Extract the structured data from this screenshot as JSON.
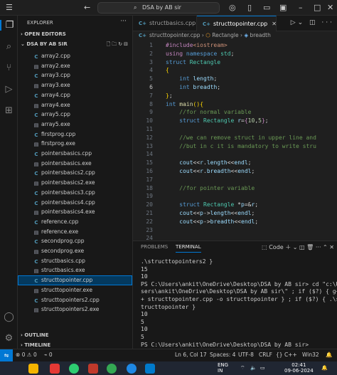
{
  "titlebar": {
    "search_text": "DSA by AB sir"
  },
  "explorer": {
    "title": "EXPLORER",
    "open_editors": "OPEN EDITORS",
    "folder": "DSA BY AB SIR",
    "files": [
      {
        "name": "array2.cpp",
        "type": "cpp"
      },
      {
        "name": "array2.exe",
        "type": "exe"
      },
      {
        "name": "array3.cpp",
        "type": "cpp"
      },
      {
        "name": "array3.exe",
        "type": "exe"
      },
      {
        "name": "array4.cpp",
        "type": "cpp"
      },
      {
        "name": "array4.exe",
        "type": "exe"
      },
      {
        "name": "array5.cpp",
        "type": "cpp"
      },
      {
        "name": "array5.exe",
        "type": "exe"
      },
      {
        "name": "firstprog.cpp",
        "type": "cpp"
      },
      {
        "name": "firstprog.exe",
        "type": "exe"
      },
      {
        "name": "pointersbasics.cpp",
        "type": "cpp"
      },
      {
        "name": "pointersbasics.exe",
        "type": "exe"
      },
      {
        "name": "pointersbasics2.cpp",
        "type": "cpp"
      },
      {
        "name": "pointersbasics2.exe",
        "type": "exe"
      },
      {
        "name": "pointersbasics3.cpp",
        "type": "cpp"
      },
      {
        "name": "pointersbasics4.cpp",
        "type": "cpp"
      },
      {
        "name": "pointersbasics4.exe",
        "type": "exe"
      },
      {
        "name": "reference.cpp",
        "type": "cpp"
      },
      {
        "name": "reference.exe",
        "type": "exe"
      },
      {
        "name": "secondprog.cpp",
        "type": "cpp"
      },
      {
        "name": "secondprog.exe",
        "type": "exe"
      },
      {
        "name": "structbasics.cpp",
        "type": "cpp"
      },
      {
        "name": "structbasics.exe",
        "type": "exe"
      },
      {
        "name": "structtopointer.cpp",
        "type": "cpp",
        "selected": true
      },
      {
        "name": "structtopointer.exe",
        "type": "exe"
      },
      {
        "name": "structtopointers2.cpp",
        "type": "cpp"
      },
      {
        "name": "structtopointers2.exe",
        "type": "exe"
      }
    ],
    "outline": "OUTLINE",
    "timeline": "TIMELINE"
  },
  "editor": {
    "tabs": [
      {
        "label": "structbasics.cpp",
        "active": false
      },
      {
        "label": "structtopointer.cpp",
        "active": true
      }
    ],
    "breadcrumb": {
      "file": "structtopointer.cpp",
      "struct": "Rectangle",
      "member": "breadth"
    },
    "current_line": 6,
    "code": [
      [
        {
          "c": "p",
          "t": "#include"
        },
        {
          "c": "s",
          "t": "<iostream>"
        }
      ],
      [
        {
          "c": "p",
          "t": "using"
        },
        {
          "c": "o",
          "t": " "
        },
        {
          "c": "k",
          "t": "namespace"
        },
        {
          "c": "o",
          "t": " "
        },
        {
          "c": "t",
          "t": "std"
        },
        {
          "c": "o",
          "t": ";"
        }
      ],
      [
        {
          "c": "k",
          "t": "struct"
        },
        {
          "c": "o",
          "t": " "
        },
        {
          "c": "t",
          "t": "Rectangle"
        }
      ],
      [
        {
          "c": "y",
          "t": "{"
        }
      ],
      [
        {
          "c": "o",
          "t": "    "
        },
        {
          "c": "k",
          "t": "int"
        },
        {
          "c": "o",
          "t": " "
        },
        {
          "c": "v",
          "t": "length"
        },
        {
          "c": "o",
          "t": ";"
        }
      ],
      [
        {
          "c": "o",
          "t": "    "
        },
        {
          "c": "k",
          "t": "int"
        },
        {
          "c": "o",
          "t": " "
        },
        {
          "c": "v",
          "t": "breadth"
        },
        {
          "c": "o",
          "t": ";"
        }
      ],
      [
        {
          "c": "y",
          "t": "}"
        },
        {
          "c": "o",
          "t": ";"
        }
      ],
      [
        {
          "c": "k",
          "t": "int"
        },
        {
          "c": "o",
          "t": " "
        },
        {
          "c": "f",
          "t": "main"
        },
        {
          "c": "y",
          "t": "()"
        },
        {
          "c": "y",
          "t": "{"
        }
      ],
      [
        {
          "c": "o",
          "t": "    "
        },
        {
          "c": "c",
          "t": "//for normal variable"
        }
      ],
      [
        {
          "c": "o",
          "t": "    "
        },
        {
          "c": "k",
          "t": "struct"
        },
        {
          "c": "o",
          "t": " "
        },
        {
          "c": "t",
          "t": "Rectangle"
        },
        {
          "c": "o",
          "t": " "
        },
        {
          "c": "v",
          "t": "r"
        },
        {
          "c": "o",
          "t": "="
        },
        {
          "c": "p",
          "t": "{"
        },
        {
          "c": "n",
          "t": "10"
        },
        {
          "c": "o",
          "t": ","
        },
        {
          "c": "n",
          "t": "5"
        },
        {
          "c": "p",
          "t": "}"
        },
        {
          "c": "o",
          "t": ";"
        }
      ],
      [],
      [
        {
          "c": "o",
          "t": "    "
        },
        {
          "c": "c",
          "t": "//we can remove struct in upper line and"
        }
      ],
      [
        {
          "c": "o",
          "t": "    "
        },
        {
          "c": "c",
          "t": "//but in c it is mandatory to write stru"
        }
      ],
      [],
      [
        {
          "c": "o",
          "t": "    "
        },
        {
          "c": "v",
          "t": "cout"
        },
        {
          "c": "o",
          "t": "<<"
        },
        {
          "c": "v",
          "t": "r"
        },
        {
          "c": "o",
          "t": "."
        },
        {
          "c": "v",
          "t": "length"
        },
        {
          "c": "o",
          "t": "<<"
        },
        {
          "c": "v",
          "t": "endl"
        },
        {
          "c": "o",
          "t": ";"
        }
      ],
      [
        {
          "c": "o",
          "t": "    "
        },
        {
          "c": "v",
          "t": "cout"
        },
        {
          "c": "o",
          "t": "<<"
        },
        {
          "c": "v",
          "t": "r"
        },
        {
          "c": "o",
          "t": "."
        },
        {
          "c": "v",
          "t": "breadth"
        },
        {
          "c": "o",
          "t": "<<"
        },
        {
          "c": "v",
          "t": "endl"
        },
        {
          "c": "o",
          "t": ";"
        }
      ],
      [],
      [
        {
          "c": "o",
          "t": "    "
        },
        {
          "c": "c",
          "t": "//for pointer variable"
        }
      ],
      [],
      [
        {
          "c": "o",
          "t": "    "
        },
        {
          "c": "k",
          "t": "struct"
        },
        {
          "c": "o",
          "t": " "
        },
        {
          "c": "t",
          "t": "Rectangle"
        },
        {
          "c": "o",
          "t": " *"
        },
        {
          "c": "v",
          "t": "p"
        },
        {
          "c": "o",
          "t": "=&"
        },
        {
          "c": "v",
          "t": "r"
        },
        {
          "c": "o",
          "t": ";"
        }
      ],
      [
        {
          "c": "o",
          "t": "    "
        },
        {
          "c": "v",
          "t": "cout"
        },
        {
          "c": "o",
          "t": "<<"
        },
        {
          "c": "v",
          "t": "p"
        },
        {
          "c": "o",
          "t": "->"
        },
        {
          "c": "v",
          "t": "length"
        },
        {
          "c": "o",
          "t": "<<"
        },
        {
          "c": "v",
          "t": "endl"
        },
        {
          "c": "o",
          "t": ";"
        }
      ],
      [
        {
          "c": "o",
          "t": "    "
        },
        {
          "c": "v",
          "t": "cout"
        },
        {
          "c": "o",
          "t": "<<"
        },
        {
          "c": "v",
          "t": "p"
        },
        {
          "c": "o",
          "t": "->"
        },
        {
          "c": "v",
          "t": "breadth"
        },
        {
          "c": "o",
          "t": "<<"
        },
        {
          "c": "v",
          "t": "endl"
        },
        {
          "c": "o",
          "t": ";"
        }
      ],
      [],
      []
    ]
  },
  "panel": {
    "tabs": [
      "PROBLEMS",
      "TERMINAL"
    ],
    "active_tab": "TERMINAL",
    "shell_label": "Code",
    "terminal_lines": [
      ".\\structtopointers2 }",
      "15",
      "10",
      "PS C:\\Users\\ankit\\OneDrive\\Desktop\\DSA by AB sir> cd \"c:\\U",
      "sers\\ankit\\OneDrive\\Desktop\\DSA by AB sir\\\" ; if ($?) { g+",
      "+ structtopointer.cpp -o structtopointer } ; if ($?) { .\\s",
      "tructtopointer }",
      "10",
      "5",
      "10",
      "5",
      "PS C:\\Users\\ankit\\OneDrive\\Desktop\\DSA by AB sir> "
    ]
  },
  "statusbar": {
    "errors": "0",
    "warnings": "0",
    "ports": "0",
    "position": "Ln 6, Col 17",
    "spaces": "Spaces: 4",
    "encoding": "UTF-8",
    "eol": "CRLF",
    "language": "C++",
    "platform": "Win32"
  },
  "taskbar": {
    "lang_line1": "ENG",
    "lang_line2": "IN",
    "time": "02:41",
    "date": "09-06-2024"
  }
}
